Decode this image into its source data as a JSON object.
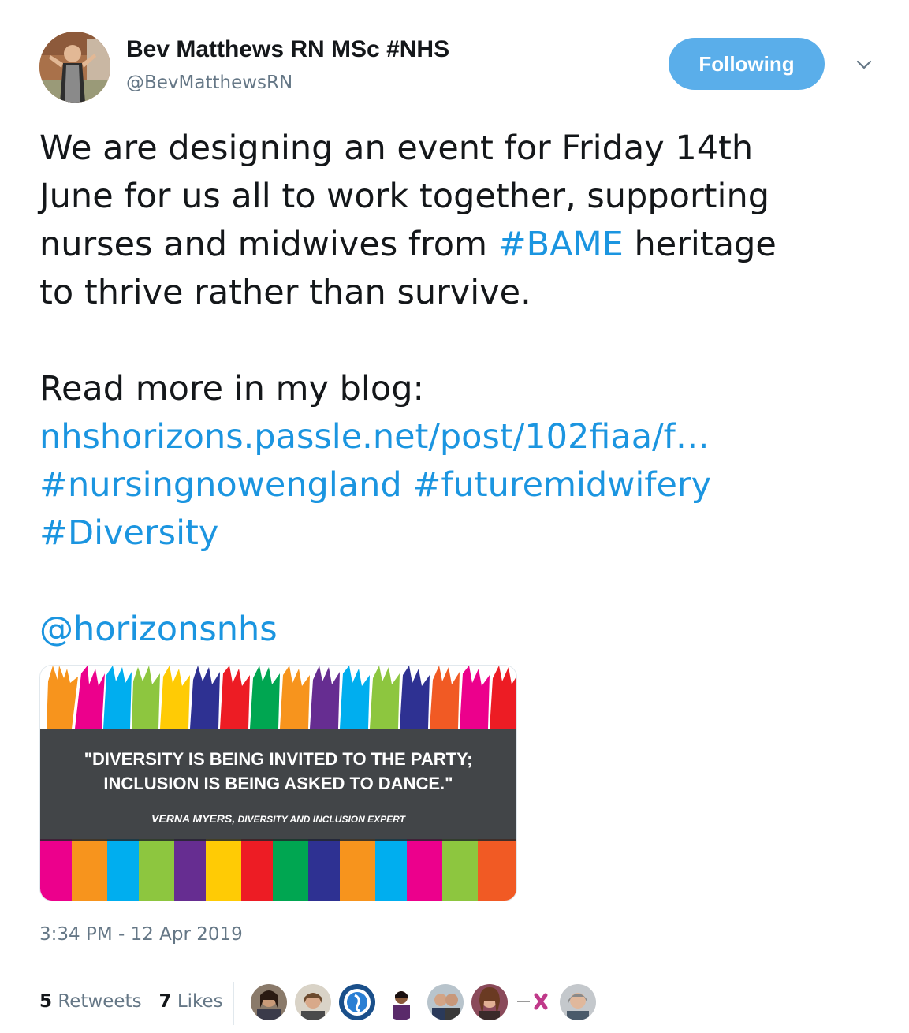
{
  "tweet": {
    "author": {
      "display_name": "Bev Matthews RN MSc #NHS",
      "handle": "@BevMatthewsRN",
      "avatar_icon": "profile-photo"
    },
    "follow_button_label": "Following",
    "menu_icon": "chevron-down-icon",
    "body": {
      "line1": "We are designing an event for Friday 14th",
      "line2": "June for us all to work together, supporting",
      "line3_before": "nurses and midwives from ",
      "line3_hashtag": "#BAME",
      "line3_after": " heritage",
      "line4": "to thrive rather than survive.",
      "line5": "Read more in my blog:",
      "link_url": "nhshorizons.passle.net/post/102fiaa/f…",
      "hashtag1": "#nursingnowengland",
      "hashtag2": "#futuremidwifery",
      "hashtag3": "#Diversity",
      "mention": "@horizonsnhs"
    },
    "media": {
      "quote_line1": "\"DIVERSITY IS BEING INVITED TO THE PARTY;",
      "quote_line2": "INCLUSION IS BEING ASKED TO DANCE.\"",
      "author_name": "VERNA MYERS,",
      "author_title": "DIVERSITY AND INCLUSION EXPERT"
    },
    "timestamp": "3:34 PM - 12 Apr 2019",
    "stats": {
      "retweets_count": "5",
      "retweets_label": "Retweets",
      "likes_count": "7",
      "likes_label": "Likes"
    },
    "colors": {
      "accent": "#1b95e0",
      "follow_button": "#5aaeea",
      "secondary_text": "#657786"
    }
  }
}
